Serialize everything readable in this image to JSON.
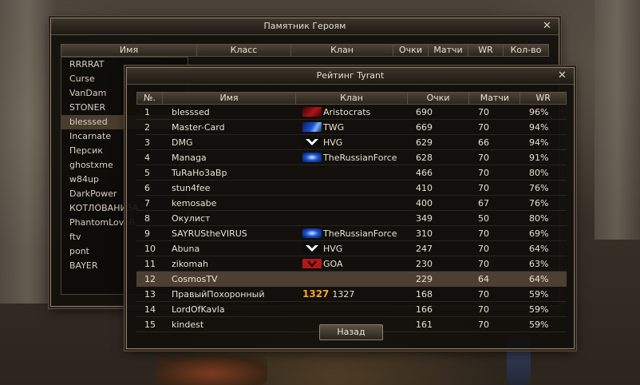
{
  "background_window": {
    "title": "Памятник Героям",
    "columns": [
      "Имя",
      "Класс",
      "Клан",
      "Очки",
      "Матчи",
      "WR",
      "Кол-во"
    ],
    "names": [
      "RRRRAT",
      "Curse",
      "VanDam",
      "STONER",
      "blesssed",
      "Incarnate",
      "Персик",
      "ghostxme",
      "w84up",
      "DarkPower",
      "КОТЛОВАНИЗА",
      "PhantomLoveR",
      "ftv",
      "pont",
      "BAYER"
    ],
    "selected_index": 4
  },
  "rating_window": {
    "title": "Рейтинг Tyrant",
    "columns": [
      "№.",
      "Имя",
      "Клан",
      "Очки",
      "Матчи",
      "WR"
    ],
    "rows": [
      {
        "num": "1",
        "name": "blesssed",
        "clan": "Aristocrats",
        "emblem": "aristocrats-emblem",
        "points": "690",
        "matches": "70",
        "wr": "96%"
      },
      {
        "num": "2",
        "name": "Master-Card",
        "clan": "TWG",
        "emblem": "twg-emblem",
        "points": "669",
        "matches": "70",
        "wr": "94%"
      },
      {
        "num": "3",
        "name": "DMG",
        "clan": "HVG",
        "emblem": "hvg-emblem",
        "points": "629",
        "matches": "66",
        "wr": "94%"
      },
      {
        "num": "4",
        "name": "Managa",
        "clan": "TheRussianForce",
        "emblem": "trf-emblem",
        "points": "628",
        "matches": "70",
        "wr": "91%"
      },
      {
        "num": "5",
        "name": "TuRaHo3aBp",
        "clan": "",
        "emblem": "",
        "points": "466",
        "matches": "70",
        "wr": "80%"
      },
      {
        "num": "6",
        "name": "stun4fee",
        "clan": "",
        "emblem": "",
        "points": "410",
        "matches": "70",
        "wr": "76%"
      },
      {
        "num": "7",
        "name": "kemosabe",
        "clan": "",
        "emblem": "",
        "points": "400",
        "matches": "67",
        "wr": "76%"
      },
      {
        "num": "8",
        "name": "Окулист",
        "clan": "",
        "emblem": "",
        "points": "349",
        "matches": "50",
        "wr": "80%"
      },
      {
        "num": "9",
        "name": "SAYRUStheVIRUS",
        "clan": "TheRussianForce",
        "emblem": "trf-emblem",
        "points": "310",
        "matches": "70",
        "wr": "69%"
      },
      {
        "num": "10",
        "name": "Abuna",
        "clan": "HVG",
        "emblem": "hvg-emblem",
        "points": "247",
        "matches": "70",
        "wr": "64%"
      },
      {
        "num": "11",
        "name": "zikomah",
        "clan": "GOA",
        "emblem": "goa-emblem",
        "points": "230",
        "matches": "70",
        "wr": "63%"
      },
      {
        "num": "12",
        "name": "CosmosTV",
        "clan": "",
        "emblem": "",
        "points": "229",
        "matches": "64",
        "wr": "64%"
      },
      {
        "num": "13",
        "name": "ПравыйПохоронный",
        "clan": "1327",
        "emblem": "1327-emblem",
        "emblem_text": "1327",
        "points": "168",
        "matches": "70",
        "wr": "59%"
      },
      {
        "num": "14",
        "name": "LordOfKavla",
        "clan": "",
        "emblem": "",
        "points": "166",
        "matches": "70",
        "wr": "59%"
      },
      {
        "num": "15",
        "name": "kindest",
        "clan": "",
        "emblem": "",
        "points": "161",
        "matches": "70",
        "wr": "59%"
      }
    ],
    "selected_index": 11,
    "back_button": "Назад",
    "close_icon": "close-icon"
  },
  "colors": {
    "aristocrats": "#b0121a",
    "twg": "#1c4fd8",
    "hvg": "#ffffff",
    "trf": "#1a54d6",
    "goa": "#b01818",
    "emblem_1327": "#f5a623"
  }
}
